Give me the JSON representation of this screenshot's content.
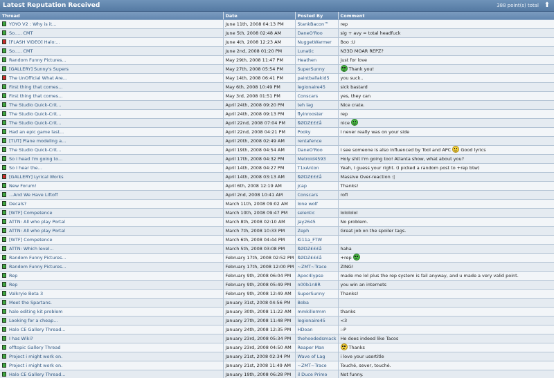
{
  "header": {
    "title": "Latest Reputation Received",
    "total": "388 point(s) total"
  },
  "colors": {
    "positive": "#3fa83f",
    "negative": "#cc2b2b"
  },
  "columns": {
    "thread": "Thread",
    "date": "Date",
    "posted_by": "Posted By",
    "comment": "Comment"
  },
  "rows": [
    {
      "thread": "YOYO V2 : Why is it...",
      "date": "June 11th, 2008 04:13 PM",
      "by": "StankBacon™",
      "comment": "rep",
      "status": "positive",
      "smiley": ""
    },
    {
      "thread": "So..... CMT",
      "date": "June 5th, 2008 02:48 AM",
      "by": "DaneO'Roo",
      "comment": "sig + avy = total headfuck",
      "status": "positive",
      "smiley": ""
    },
    {
      "thread": "[FLASH VIDEO] Halo:...",
      "date": "June 4th, 2008 12:23 AM",
      "by": "NuggetWarmer",
      "comment": "Boo :U",
      "status": "negative",
      "smiley": ""
    },
    {
      "thread": "So..... CMT",
      "date": "June 2nd, 2008 01:20 PM",
      "by": "Lunatic",
      "comment": "N33D MOAR REPZ?",
      "status": "positive",
      "smiley": ""
    },
    {
      "thread": "Random Funny Pictures...",
      "date": "May 29th, 2008 11:47 PM",
      "by": "Heathen",
      "comment": "just for love",
      "status": "positive",
      "smiley": ""
    },
    {
      "thread": "[GALLERY] Sunny's Supers",
      "date": "May 27th, 2008 05:54 PM",
      "by": "SuperSunny",
      "comment": "Thank you!",
      "status": "positive",
      "smiley": "green"
    },
    {
      "thread": "The UnOfficial What Are...",
      "date": "May 14th, 2008 06:41 PM",
      "by": "paintballakid5",
      "comment": "you suck..",
      "status": "negative",
      "smiley": ""
    },
    {
      "thread": "First thing that comes...",
      "date": "May 6th, 2008 10:49 PM",
      "by": "legionaire45",
      "comment": "sick bastard",
      "status": "positive",
      "smiley": ""
    },
    {
      "thread": "First thing that comes...",
      "date": "May 3rd, 2008 01:51 PM",
      "by": "Conscars",
      "comment": "yes, they can",
      "status": "positive",
      "smiley": ""
    },
    {
      "thread": "The Studio Quick-Crit...",
      "date": "April 24th, 2008 09:20 PM",
      "by": "teh lag",
      "comment": "Nice crate.",
      "status": "positive",
      "smiley": ""
    },
    {
      "thread": "The Studio Quick-Crit...",
      "date": "April 24th, 2008 09:13 PM",
      "by": "flyinrooster",
      "comment": "rep",
      "status": "positive",
      "smiley": ""
    },
    {
      "thread": "The Studio Quick-Crit...",
      "date": "April 22nd, 2008 07:04 PM",
      "by": "ßØDZ£££å",
      "comment": "nice",
      "status": "positive",
      "smiley": "green"
    },
    {
      "thread": "Had an epic game last...",
      "date": "April 22nd, 2008 04:21 PM",
      "by": "Pooky",
      "comment": "I never really was on your side",
      "status": "positive",
      "smiley": ""
    },
    {
      "thread": "[TUT] Plane modeling a...",
      "date": "April 20th, 2008 02:49 AM",
      "by": "rentafence",
      "comment": "",
      "status": "positive",
      "smiley": ""
    },
    {
      "thread": "The Studio Quick-Crit...",
      "date": "April 19th, 2008 04:54 AM",
      "by": "DaneO'Roo",
      "comment": "I see someone is also influenced by Tool and APC",
      "comment2": "Good lyrics",
      "status": "positive",
      "smiley": "yellow"
    },
    {
      "thread": "So i head i'm going to...",
      "date": "April 17th, 2008 04:32 PM",
      "by": "Metroid4593",
      "comment": "Holy shit I'm going too! Atlanta show, what about you?",
      "status": "positive",
      "smiley": ""
    },
    {
      "thread": "So I hear the...",
      "date": "April 14th, 2008 04:27 PM",
      "by": "T1xAnton",
      "comment": "Yeah, I guess your right. (I picked a random post to +rep btw)",
      "status": "positive",
      "smiley": ""
    },
    {
      "thread": "[GALLERY] Lyrical Works",
      "date": "April 14th, 2008 03:13 AM",
      "by": "ßØDZ£££å",
      "comment": "Massive Over-reaction :|",
      "status": "negative",
      "smiley": ""
    },
    {
      "thread": "New Forum!",
      "date": "April 6th, 2008 12:19 AM",
      "by": "jcap",
      "comment": "Thanks!",
      "status": "positive",
      "smiley": ""
    },
    {
      "thread": "...And We Have Liftoff",
      "date": "April 2nd, 2008 10:41 AM",
      "by": "Conscars",
      "comment": "rofl",
      "status": "positive",
      "smiley": ""
    },
    {
      "thread": "Decals?",
      "date": "March 11th, 2008 09:02 AM",
      "by": "lone wolf",
      "comment": "",
      "status": "positive",
      "smiley": ""
    },
    {
      "thread": "[WTF] Competence",
      "date": "March 10th, 2008 09:47 PM",
      "by": "selentic",
      "comment": "lolololol",
      "status": "positive",
      "smiley": ""
    },
    {
      "thread": "ATTN: All who play Portal",
      "date": "March 8th, 2008 02:10 AM",
      "by": "Jay2645",
      "comment": "No problem.",
      "status": "positive",
      "smiley": ""
    },
    {
      "thread": "ATTN: All who play Portal",
      "date": "March 7th, 2008 10:33 PM",
      "by": "Zeph",
      "comment": "Great job on the spoiler tags.",
      "status": "positive",
      "smiley": ""
    },
    {
      "thread": "[WTF] Competence",
      "date": "March 6th, 2008 04:44 PM",
      "by": "Ki11a_FTW",
      "comment": "",
      "status": "positive",
      "smiley": ""
    },
    {
      "thread": "ATTN: Which level...",
      "date": "March 5th, 2008 03:08 PM",
      "by": "ßØDZ£££å",
      "comment": "haha",
      "status": "positive",
      "smiley": ""
    },
    {
      "thread": "Random Funny Pictures...",
      "date": "February 17th, 2008 02:52 PM",
      "by": "ßØDZ£££å",
      "comment": "+rep",
      "status": "positive",
      "smiley": "green"
    },
    {
      "thread": "Random Funny Pictures...",
      "date": "February 17th, 2008 12:00 PM",
      "by": "~ZMT~Trace",
      "comment": "ZING!",
      "status": "positive",
      "smiley": ""
    },
    {
      "thread": "Rep",
      "date": "February 9th, 2008 06:04 PM",
      "by": "Apoc4lypse",
      "comment": "made me lol plus the rep system is fail anyway, and u made a very valid point.",
      "status": "positive",
      "smiley": ""
    },
    {
      "thread": "Rep",
      "date": "February 9th, 2008 05:49 PM",
      "by": "n00b1n8R",
      "comment": "you win an internets",
      "status": "positive",
      "smiley": ""
    },
    {
      "thread": "Valkryie Beta 3",
      "date": "February 9th, 2008 12:49 AM",
      "by": "SuperSunny",
      "comment": "Thanks!",
      "status": "positive",
      "smiley": ""
    },
    {
      "thread": "Meet the Spartans.",
      "date": "January 31st, 2008 04:56 PM",
      "by": "Boba",
      "comment": "",
      "status": "positive",
      "smiley": ""
    },
    {
      "thread": "halo editing kit problem",
      "date": "January 30th, 2008 11:22 AM",
      "by": "mmkillermm",
      "comment": "thanks",
      "status": "positive",
      "smiley": ""
    },
    {
      "thread": "Looking for a cheap...",
      "date": "January 27th, 2008 11:48 PM",
      "by": "legionaire45",
      "comment": "<3",
      "status": "positive",
      "smiley": ""
    },
    {
      "thread": "Halo CE Gallery Thread...",
      "date": "January 24th, 2008 12:35 PM",
      "by": "HDoan",
      "comment": ":-P",
      "status": "positive",
      "smiley": ""
    },
    {
      "thread": "I has Wiki?",
      "date": "January 23rd, 2008 05:34 PM",
      "by": "thehoodedsmack",
      "comment": "He does indeed like Tacos",
      "status": "positive",
      "smiley": ""
    },
    {
      "thread": "offtopic Gallery Thread",
      "date": "January 23rd, 2008 04:50 AM",
      "by": "Reaper Man",
      "comment": "Thanks",
      "status": "positive",
      "smiley": "yellow-lead"
    },
    {
      "thread": "Project i might work on.",
      "date": "January 21st, 2008 02:34 PM",
      "by": "Wave of Lag",
      "comment": "i love your usertitle",
      "status": "positive",
      "smiley": ""
    },
    {
      "thread": "Project i might work on.",
      "date": "January 21st, 2008 11:49 AM",
      "by": "~ZMT~Trace",
      "comment": "Touché, sever, touché.",
      "status": "positive",
      "smiley": ""
    },
    {
      "thread": "Halo CE Gallery Thread...",
      "date": "January 19th, 2008 06:28 PM",
      "by": "il Duce Primo",
      "comment": "Not funny.",
      "status": "positive",
      "smiley": ""
    }
  ]
}
